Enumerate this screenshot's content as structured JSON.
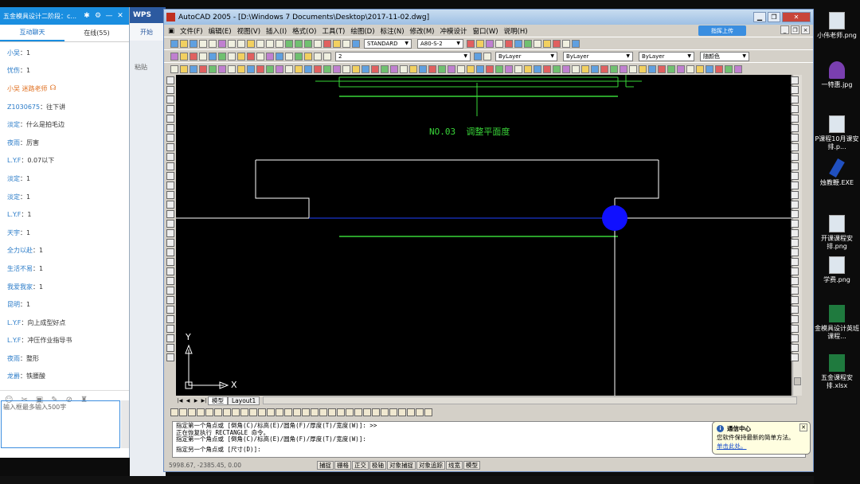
{
  "chat": {
    "title": "五金模具设计二阶段：c...",
    "tabs": [
      "互动聊天",
      "在线(55)"
    ],
    "messages": [
      {
        "user": "小吴",
        "text": "1"
      },
      {
        "user": "忧伤",
        "text": "1"
      },
      {
        "user": "小吴 迷路老师",
        "text": "",
        "teacher": true
      },
      {
        "user": "Z1030675",
        "text": "往下讲"
      },
      {
        "user": "淡定",
        "text": "什么是拍毛边"
      },
      {
        "user": "夜雨",
        "text": "厉害"
      },
      {
        "user": "L.Y.F",
        "text": "0.07以下"
      },
      {
        "user": "淡定",
        "text": "1"
      },
      {
        "user": "淡定",
        "text": "1"
      },
      {
        "user": "L.Y.F",
        "text": "1"
      },
      {
        "user": "天宇",
        "text": "1"
      },
      {
        "user": "全力以赴",
        "text": "1"
      },
      {
        "user": "生活不易",
        "text": "1"
      },
      {
        "user": "我爱我家",
        "text": "1"
      },
      {
        "user": "昆明",
        "text": "1"
      },
      {
        "user": "L.Y.F",
        "text": "向上成型好点"
      },
      {
        "user": "L.Y.F",
        "text": "冲压作业指导书"
      },
      {
        "user": "夜雨",
        "text": "整形"
      },
      {
        "user": "龙爵",
        "text": "铁腰酸"
      }
    ],
    "input_placeholder": "输入框最多输入500字"
  },
  "wps": {
    "title": "WPS",
    "tab": "开始",
    "paste": "粘贴"
  },
  "acad": {
    "title": "AutoCAD 2005 - [D:\\Windows 7 Documents\\Desktop\\2017-11-02.dwg]",
    "menus": [
      "文件(F)",
      "编辑(E)",
      "视图(V)",
      "插入(I)",
      "格式(O)",
      "工具(T)",
      "绘图(D)",
      "标注(N)",
      "修改(M)",
      "冲模设计",
      "窗口(W)",
      "说明(H)"
    ],
    "share_button": "指挥上传",
    "text_style": "STANDARD",
    "dim_style": "A80-S-2",
    "layer": "2",
    "color": "ByLayer",
    "linetype": "ByLayer",
    "lineweight": "ByLayer",
    "plot_style": "随颜色",
    "drawing_text": "NO.03  调整平面度",
    "ucs_x": "X",
    "ucs_y": "Y",
    "layout_tabs": [
      "模型",
      "Layout1"
    ],
    "command_lines": [
      "指定第一个角点或 [倒角(C)/标高(E)/圆角(F)/厚度(T)/宽度(W)]: >>",
      "正在恢复执行 RECTANGLE 命令。",
      "指定第一个角点或 [倒角(C)/标高(E)/圆角(F)/厚度(T)/宽度(W)]:",
      "指定另一个角点或 [尺寸(D)]:"
    ],
    "coords": "5998.67, -2385.45, 0.00",
    "status_buttons": [
      "捕捉",
      "栅格",
      "正交",
      "极轴",
      "对象捕捉",
      "对象追踪",
      "线宽",
      "模型"
    ]
  },
  "notification": {
    "title": "通信中心",
    "body": "您软件保持最新的简单方法。",
    "link": "单击此处。"
  },
  "desktop": [
    {
      "label": "小伟老师.png",
      "type": "png"
    },
    {
      "label": "一特惠.jpg",
      "type": "jpg"
    },
    {
      "label": "P课程10月课安排.p...",
      "type": "png"
    },
    {
      "label": "烛教鞭.EXE",
      "type": "exe"
    },
    {
      "label": "开课课程安排.png",
      "type": "png"
    },
    {
      "label": "学费.png",
      "type": "png"
    },
    {
      "label": "金模具设计英班课程...",
      "type": "xls"
    },
    {
      "label": "五金课程安排.xlsx",
      "type": "xls"
    }
  ],
  "colors": {
    "chat_header": "#1a8ee0",
    "cad_green": "#39d639",
    "cad_white": "#ffffff",
    "cad_blue_grip": "#1010ff"
  }
}
